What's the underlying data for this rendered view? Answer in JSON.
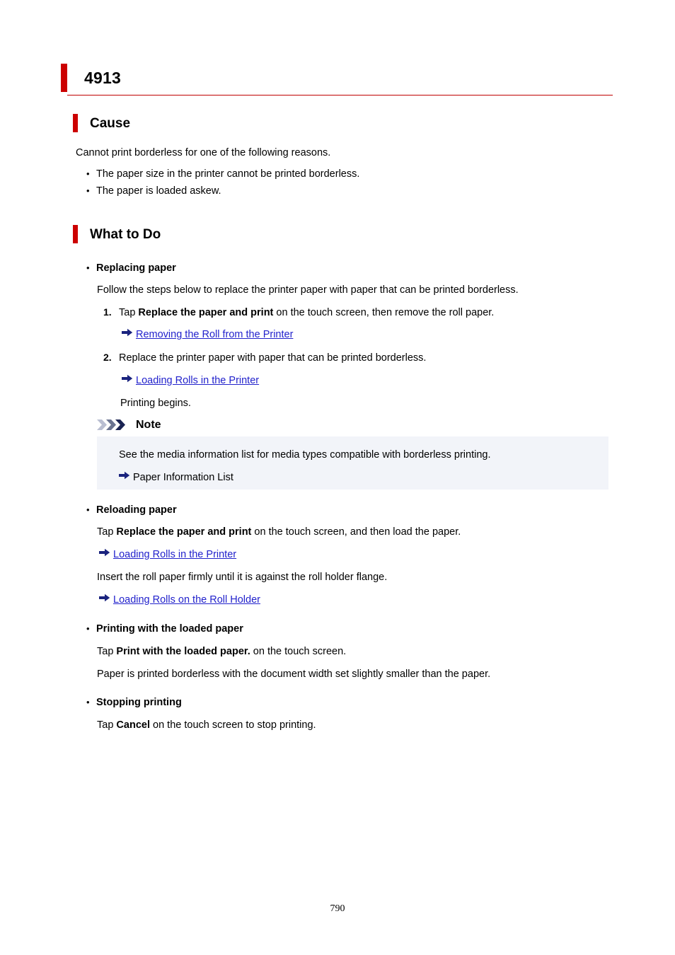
{
  "document": {
    "title": "4913",
    "page_number": "790",
    "accent_color": "#cc0000",
    "link_color": "#2222cc",
    "note_background": "#f2f4f9"
  },
  "cause": {
    "heading": "Cause",
    "intro": "Cannot print borderless for one of the following reasons.",
    "reasons": [
      "The paper size in the printer cannot be printed borderless.",
      "The paper is loaded askew."
    ]
  },
  "what_to_do": {
    "heading": "What to Do",
    "replacing": {
      "label": "Replacing paper",
      "intro": "Follow the steps below to replace the printer paper with paper that can be printed borderless.",
      "step1": {
        "marker": "1.",
        "prefix": "Tap ",
        "bold": "Replace the paper and print",
        "suffix": " on the touch screen, then remove the roll paper.",
        "link": "Removing the Roll from the Printer"
      },
      "step2": {
        "marker": "2.",
        "text": "Replace the printer paper with paper that can be printed borderless.",
        "link": "Loading Rolls in the Printer",
        "after": "Printing begins."
      },
      "note": {
        "title": "Note",
        "text": "See the media information list for media types compatible with borderless printing.",
        "reference": "Paper Information List"
      }
    },
    "reloading": {
      "label": "Reloading paper",
      "line1_prefix": "Tap ",
      "line1_bold": "Replace the paper and print",
      "line1_suffix": " on the touch screen, and then load the paper.",
      "link1": "Loading Rolls in the Printer",
      "line2": "Insert the roll paper firmly until it is against the roll holder flange.",
      "link2": "Loading Rolls on the Roll Holder"
    },
    "printing_loaded": {
      "label": "Printing with the loaded paper",
      "line1_prefix": "Tap ",
      "line1_bold": "Print with the loaded paper.",
      "line1_suffix": " on the touch screen.",
      "line2": "Paper is printed borderless with the document width set slightly smaller than the paper."
    },
    "stopping": {
      "label": "Stopping printing",
      "line1_prefix": "Tap ",
      "line1_bold": "Cancel",
      "line1_suffix": " on the touch screen to stop printing."
    }
  }
}
